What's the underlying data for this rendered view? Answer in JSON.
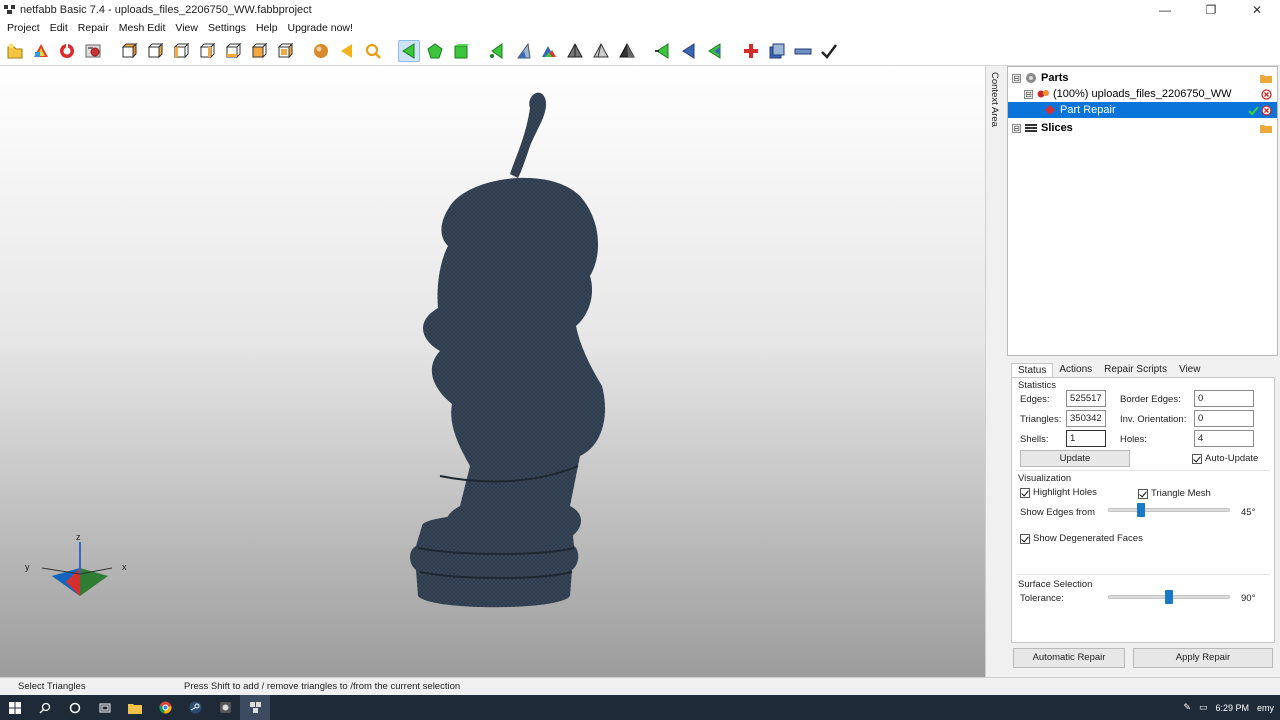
{
  "window": {
    "title": "netfabb Basic 7.4 - uploads_files_2206750_WW.fabbproject",
    "minimize": "—",
    "maximize": "❐",
    "close": "✕"
  },
  "menu": [
    "Project",
    "Edit",
    "Repair",
    "Mesh Edit",
    "View",
    "Settings",
    "Help",
    "Upgrade now!"
  ],
  "toolbar_icons": [
    "new-project-icon",
    "add-part-icon",
    "repair-icon",
    "settings-icon",
    "view-front-icon",
    "view-back-icon",
    "view-left-icon",
    "view-right-icon",
    "view-top-icon",
    "view-bottom-icon",
    "view-sphere-icon",
    "arrow-left-icon",
    "zoom-icon",
    "select-triangle-icon",
    "select-surface-icon",
    "select-shell-icon",
    "triangle-green-icon",
    "triangle-blue-icon",
    "triangle-multi-icon",
    "pyramid-icon",
    "pyramid-outline-icon",
    "pyramid-dark-icon",
    "arrow-green-icon",
    "arrow-blue-icon",
    "arrow-teal-icon",
    "add-red-icon",
    "transform-icon",
    "bar-icon",
    "apply-check-icon"
  ],
  "context_area_label": "Context Area",
  "tree": {
    "parts_label": "Parts",
    "part_label": "(100%) uploads_files_2206750_WW",
    "repair_label": "Part Repair",
    "slices_label": "Slices"
  },
  "tabs": [
    "Status",
    "Actions",
    "Repair Scripts",
    "View"
  ],
  "status": {
    "statistics_label": "Statistics",
    "edges_label": "Edges:",
    "edges_value": "525517",
    "triangles_label": "Triangles:",
    "triangles_value": "350342",
    "shells_label": "Shells:",
    "shells_value": "1",
    "border_edges_label": "Border Edges:",
    "border_edges_value": "0",
    "inv_orientation_label": "Inv. Orientation:",
    "inv_orientation_value": "0",
    "holes_label": "Holes:",
    "holes_value": "4",
    "update_label": "Update",
    "auto_update_label": "Auto-Update",
    "visualization_label": "Visualization",
    "highlight_holes_label": "Highlight Holes",
    "triangle_mesh_label": "Triangle Mesh",
    "show_edges_label": "Show Edges from",
    "show_edges_value": "45°",
    "show_edges_level": 0.25,
    "degenerated_label": "Show Degenerated Faces",
    "surface_selection_label": "Surface Selection",
    "tolerance_label": "Tolerance:",
    "tolerance_value": "90°",
    "tolerance_level": 0.5
  },
  "buttons": {
    "automatic_repair": "Automatic Repair",
    "apply_repair": "Apply Repair"
  },
  "statusbar": {
    "mode": "Select Triangles",
    "hint": "Press Shift to add / remove triangles to /from the current selection"
  },
  "axis": {
    "x": "x",
    "y": "y",
    "z": "z"
  },
  "taskbar": {
    "time": "6:29 PM",
    "user": "emy"
  }
}
